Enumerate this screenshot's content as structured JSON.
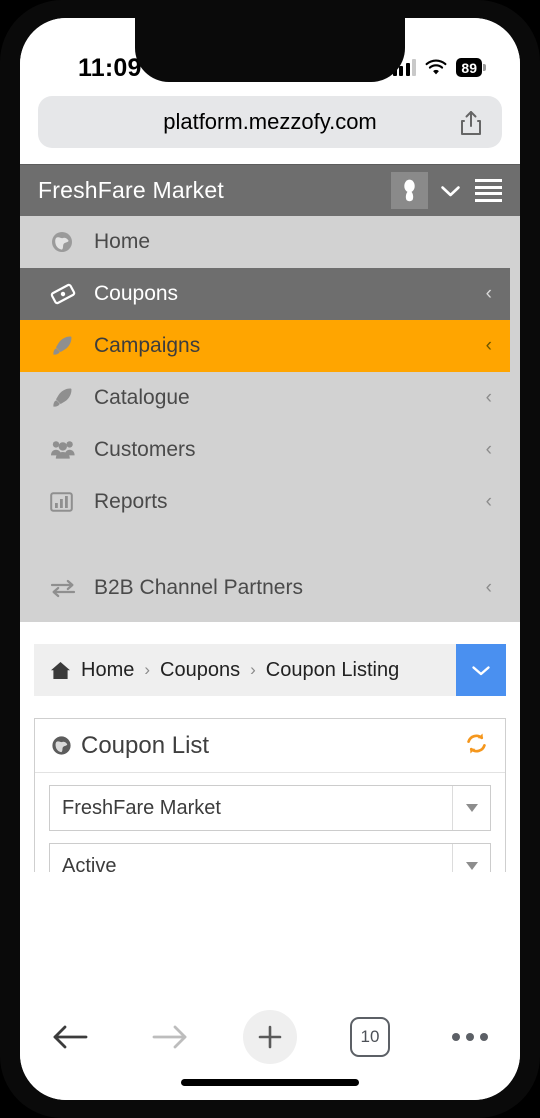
{
  "status_bar": {
    "time": "11:09",
    "battery_percent": "89",
    "signal_icon": "cellular-bars-icon",
    "wifi_icon": "wifi-icon",
    "battery_icon": "battery-icon"
  },
  "browser": {
    "url": "platform.mezzofy.com",
    "share_icon": "share-icon",
    "toolbar": {
      "back_icon": "back-arrow-icon",
      "forward_icon": "forward-arrow-icon",
      "new_tab_icon": "plus-icon",
      "tab_count": "10",
      "more_icon": "more-dots-icon"
    }
  },
  "app_header": {
    "title": "FreshFare Market",
    "avatar_icon": "user-avatar-icon",
    "chevron_icon": "chevron-down-icon",
    "menu_icon": "hamburger-menu-icon"
  },
  "nav": {
    "items": [
      {
        "label": "Home",
        "icon": "globe-icon",
        "caret": "",
        "state": "default"
      },
      {
        "label": "Coupons",
        "icon": "ticket-icon",
        "caret": "‹",
        "state": "active-dark"
      },
      {
        "label": "Campaigns",
        "icon": "rocket-icon",
        "caret": "‹",
        "state": "active-orange"
      },
      {
        "label": "Catalogue",
        "icon": "rocket-icon",
        "caret": "‹",
        "state": "default"
      },
      {
        "label": "Customers",
        "icon": "users-icon",
        "caret": "‹",
        "state": "default"
      },
      {
        "label": "Reports",
        "icon": "bar-chart-icon",
        "caret": "‹",
        "state": "default"
      },
      {
        "label": "B2B Channel Partners",
        "icon": "exchange-icon",
        "caret": "‹",
        "state": "default"
      }
    ]
  },
  "breadcrumb": {
    "home_icon": "home-icon",
    "items": [
      "Home",
      "Coupons",
      "Coupon Listing"
    ],
    "separator": "›",
    "toggle_icon": "chevron-down-icon"
  },
  "card": {
    "title": "Coupon List",
    "title_icon": "globe-icon",
    "refresh_icon": "refresh-icon",
    "merchant_select": {
      "value": "FreshFare Market"
    },
    "status_select": {
      "value": "Active"
    },
    "search": {
      "button_icon": "search-icon",
      "value": "",
      "placeholder": ""
    },
    "table_columns": [
      "",
      "",
      "",
      ""
    ]
  },
  "colors": {
    "header_gray": "#6e6e6e",
    "nav_gray": "#d2d2d2",
    "accent_orange": "#ffa500",
    "accent_blue": "#4a90f0",
    "refresh_orange": "#f5971d"
  }
}
